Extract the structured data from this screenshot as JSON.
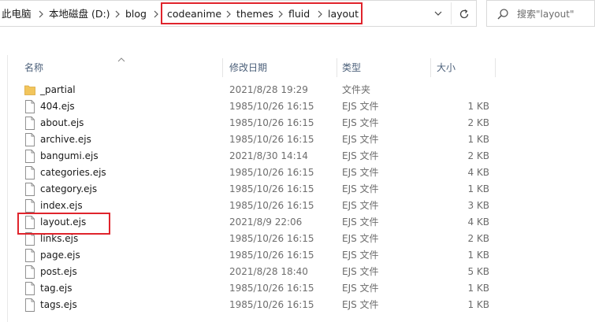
{
  "breadcrumb": {
    "items": [
      "此电脑",
      "本地磁盘 (D:)",
      "blog",
      "codeanime",
      "themes",
      "fluid",
      "layout"
    ]
  },
  "search": {
    "placeholder": "搜索\"layout\""
  },
  "columns": {
    "name": "名称",
    "date": "修改日期",
    "type": "类型",
    "size": "大小"
  },
  "files": [
    {
      "name": "_partial",
      "date": "2021/8/28 19:29",
      "type": "文件夹",
      "size": "",
      "kind": "folder"
    },
    {
      "name": "404.ejs",
      "date": "1985/10/26 16:15",
      "type": "EJS 文件",
      "size": "1 KB",
      "kind": "file"
    },
    {
      "name": "about.ejs",
      "date": "1985/10/26 16:15",
      "type": "EJS 文件",
      "size": "2 KB",
      "kind": "file"
    },
    {
      "name": "archive.ejs",
      "date": "1985/10/26 16:15",
      "type": "EJS 文件",
      "size": "1 KB",
      "kind": "file"
    },
    {
      "name": "bangumi.ejs",
      "date": "2021/8/30 14:14",
      "type": "EJS 文件",
      "size": "2 KB",
      "kind": "file"
    },
    {
      "name": "categories.ejs",
      "date": "1985/10/26 16:15",
      "type": "EJS 文件",
      "size": "4 KB",
      "kind": "file"
    },
    {
      "name": "category.ejs",
      "date": "1985/10/26 16:15",
      "type": "EJS 文件",
      "size": "1 KB",
      "kind": "file"
    },
    {
      "name": "index.ejs",
      "date": "1985/10/26 16:15",
      "type": "EJS 文件",
      "size": "3 KB",
      "kind": "file"
    },
    {
      "name": "layout.ejs",
      "date": "2021/8/9 22:06",
      "type": "EJS 文件",
      "size": "4 KB",
      "kind": "file"
    },
    {
      "name": "links.ejs",
      "date": "1985/10/26 16:15",
      "type": "EJS 文件",
      "size": "2 KB",
      "kind": "file"
    },
    {
      "name": "page.ejs",
      "date": "1985/10/26 16:15",
      "type": "EJS 文件",
      "size": "1 KB",
      "kind": "file"
    },
    {
      "name": "post.ejs",
      "date": "2021/8/28 18:40",
      "type": "EJS 文件",
      "size": "5 KB",
      "kind": "file"
    },
    {
      "name": "tag.ejs",
      "date": "1985/10/26 16:15",
      "type": "EJS 文件",
      "size": "1 KB",
      "kind": "file"
    },
    {
      "name": "tags.ejs",
      "date": "1985/10/26 16:15",
      "type": "EJS 文件",
      "size": "1 KB",
      "kind": "file"
    }
  ],
  "colors": {
    "highlight": "#e0242c",
    "folder": "#f2c55c",
    "header_text": "#4c607a"
  },
  "icons": {
    "folder": "folder-icon",
    "file": "file-icon",
    "refresh": "refresh-icon",
    "search": "search-icon",
    "dropdown": "chevron-down-icon"
  }
}
